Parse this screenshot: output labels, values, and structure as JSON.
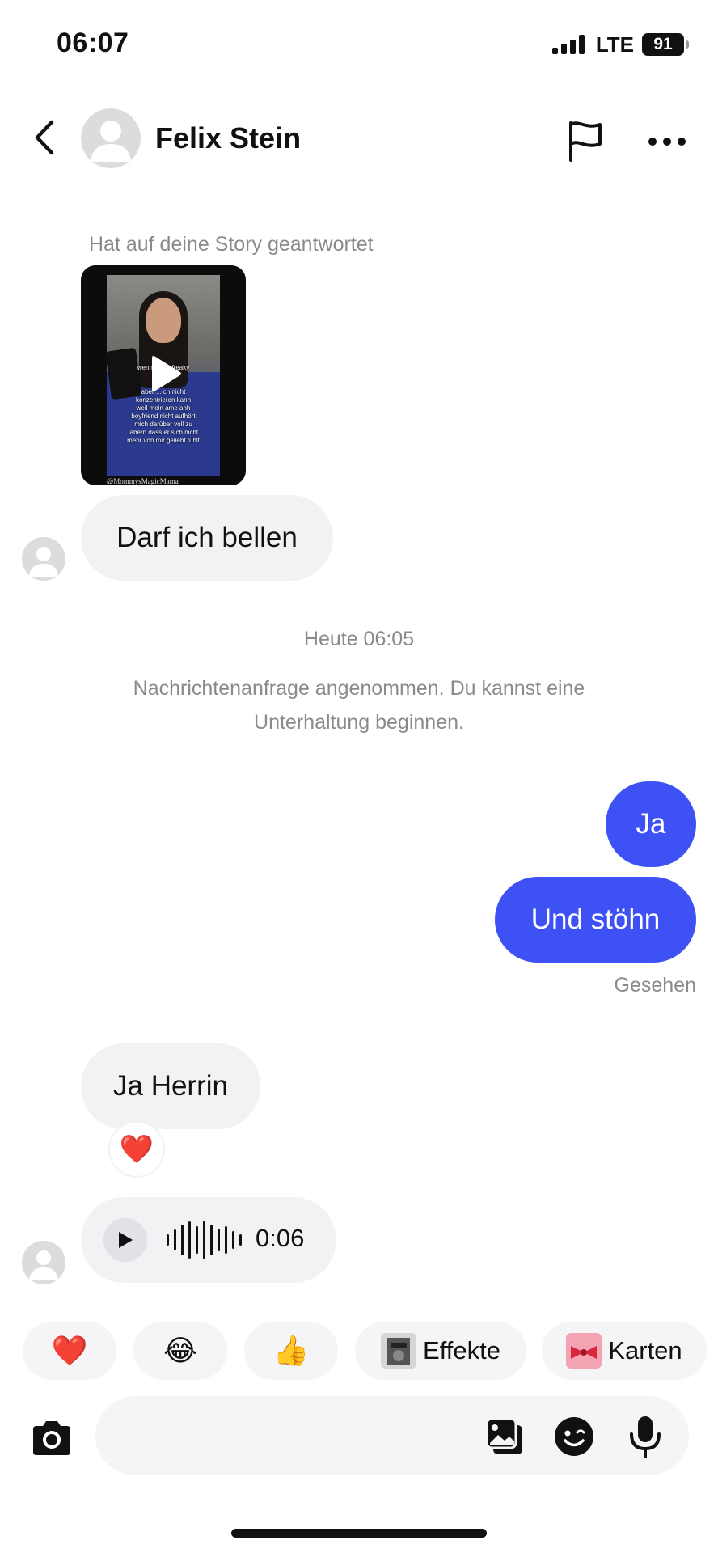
{
  "status_bar": {
    "time": "06:07",
    "network": "LTE",
    "battery": "91"
  },
  "header": {
    "contact_name": "Felix Stein"
  },
  "messages": {
    "story_caption": "Hat auf deine Story geantwortet",
    "story_overlay_text": "wenn ich ... freaky\nmit ... h\n\naber ... ch nicht\nkonzentrieren kann\nweil mein ame ahh\nboyfriend nicht aufhört\nmich darüber voll zu\nlabern dass er sich nicht\nmehr von mir geliebt fühlt",
    "story_credit": "@MommysMagicMama",
    "incoming_1": "Darf ich bellen",
    "timestamp": "Heute 06:05",
    "system_message_line1": "Nachrichtenanfrage angenommen. Du kannst eine",
    "system_message_line2": "Unterhaltung beginnen.",
    "outgoing_1": "Ja",
    "outgoing_2": "Und stöhn",
    "seen_label": "Gesehen",
    "incoming_2": "Ja Herrin",
    "reaction_emoji": "❤️",
    "voice_duration": "0:06"
  },
  "quick_actions": {
    "heart": "❤️",
    "laugh": "😂",
    "thumbs_up": "👍",
    "effects_label": "Effekte",
    "cards_label": "Karten"
  },
  "composer": {
    "placeholder": ""
  },
  "colors": {
    "accent": "#3e51f5",
    "incoming_bubble": "#f2f2f4",
    "meta_text": "#8a8a8e"
  },
  "icons": [
    "back-icon",
    "flag-icon",
    "more-icon",
    "play-icon",
    "camera-icon",
    "gallery-icon",
    "sticker-icon",
    "microphone-icon"
  ]
}
